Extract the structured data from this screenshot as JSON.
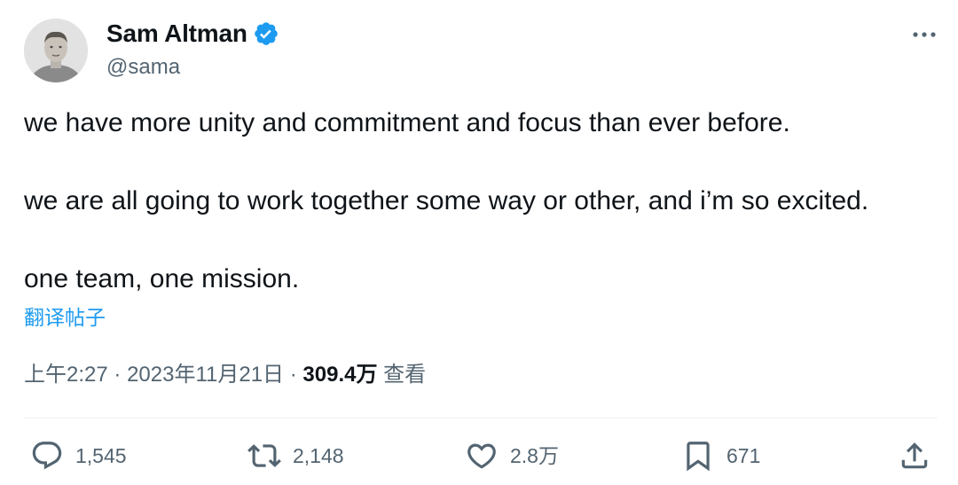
{
  "author": {
    "name": "Sam Altman",
    "handle": "@sama",
    "verified": true
  },
  "tweet": {
    "lines": [
      "we have more unity and commitment and focus than ever before.",
      "we are all going to work together some way or other, and i’m so excited.",
      "one team, one mission."
    ],
    "translate_label": "翻译帖子",
    "time": "上午2:27",
    "date": "2023年11月21日",
    "separator": "·",
    "views_count": "309.4万",
    "views_label": "查看"
  },
  "actions": {
    "replies": "1,545",
    "retweets": "2,148",
    "likes": "2.8万",
    "bookmarks": "671"
  },
  "colors": {
    "text": "#0f1419",
    "secondary": "#536471",
    "accent": "#1d9bf0",
    "divider": "#eff3f4"
  },
  "icons": {
    "verified": "verified-badge-icon",
    "more": "more-horizontal-icon",
    "reply": "reply-icon",
    "retweet": "retweet-icon",
    "like": "heart-icon",
    "bookmark": "bookmark-icon",
    "share": "share-icon"
  }
}
